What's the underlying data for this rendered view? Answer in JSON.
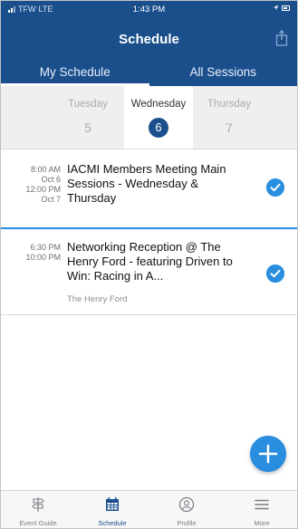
{
  "status_bar": {
    "carrier": "TFW",
    "network": "LTE",
    "time": "1:43 PM"
  },
  "header": {
    "title": "Schedule",
    "share_icon": "share-icon"
  },
  "tabs": [
    {
      "label": "My Schedule",
      "selected": true
    },
    {
      "label": "All Sessions",
      "selected": false
    }
  ],
  "days": [
    {
      "name": "Tuesday",
      "number": "5",
      "selected": false
    },
    {
      "name": "Wednesday",
      "number": "6",
      "selected": true
    },
    {
      "name": "Thursday",
      "number": "7",
      "selected": false
    }
  ],
  "events": [
    {
      "start_time": "8:00 AM",
      "start_date": "Oct 6",
      "end_time": "12:00 PM",
      "end_date": "Oct 7",
      "title": "IACMI Members Meeting Main Sessions - Wednesday & Thursday",
      "location": "",
      "added": true
    },
    {
      "start_time": "6:30 PM",
      "start_date": "",
      "end_time": "10:00 PM",
      "end_date": "",
      "title": "Networking Reception @ The Henry Ford - featuring Driven to Win: Racing in A...",
      "location": "The Henry Ford",
      "added": true
    }
  ],
  "fab": {
    "icon": "plus-icon"
  },
  "bottom_nav": [
    {
      "label": "Event Guide",
      "icon": "signpost-icon",
      "active": false
    },
    {
      "label": "Schedule",
      "icon": "calendar-icon",
      "active": true
    },
    {
      "label": "Profile",
      "icon": "profile-icon",
      "active": false
    },
    {
      "label": "More",
      "icon": "menu-icon",
      "active": false
    }
  ],
  "colors": {
    "header": "#1b4f8c",
    "accent": "#2a8ee0",
    "day_strip": "#efeff0"
  }
}
